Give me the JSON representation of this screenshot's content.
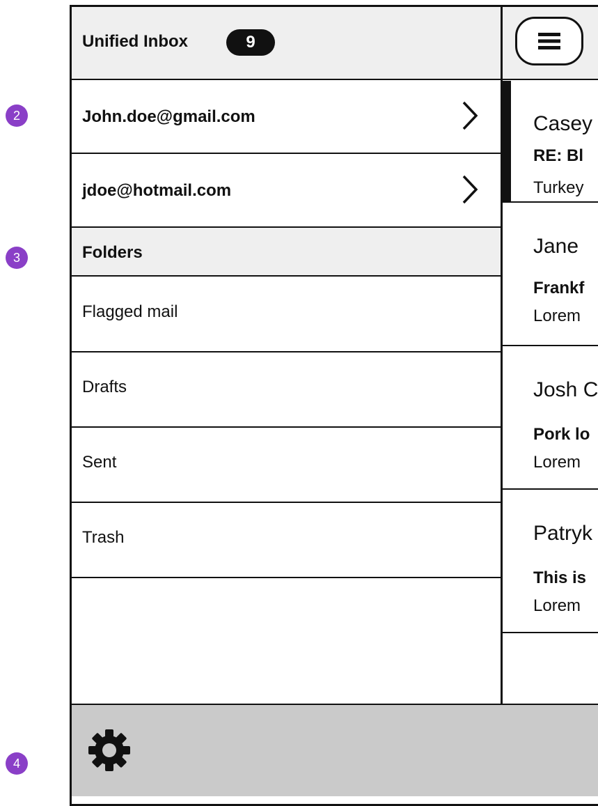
{
  "annotations": {
    "marker_2": "2",
    "marker_3": "3",
    "marker_4": "4"
  },
  "inbox": {
    "title": "Unified Inbox",
    "badge_count": "9"
  },
  "accounts": [
    {
      "label": "John.doe@gmail.com"
    },
    {
      "label": "jdoe@hotmail.com"
    }
  ],
  "folders": {
    "header": "Folders",
    "items": [
      {
        "label": "Flagged mail"
      },
      {
        "label": "Drafts"
      },
      {
        "label": "Sent"
      },
      {
        "label": "Trash"
      }
    ]
  },
  "messages": [
    {
      "sender": "Casey",
      "subject": "RE: Bl",
      "preview": "Turkey",
      "selected": true
    },
    {
      "sender": "Jane",
      "subject": "Frankf",
      "preview": "Lorem",
      "selected": false
    },
    {
      "sender": "Josh C",
      "subject": "Pork lo",
      "preview": "Lorem",
      "selected": false
    },
    {
      "sender": "Patryk",
      "subject": "This is",
      "preview": "Lorem",
      "selected": false
    }
  ],
  "icons": {
    "menu": "hamburger-menu-icon",
    "settings": "gear-icon",
    "account_chevron": "chevron-right-icon"
  },
  "colors": {
    "marker": "#8a3fc7",
    "header_bg": "#efefef",
    "footer_bg": "#cacaca",
    "border": "#111111"
  }
}
